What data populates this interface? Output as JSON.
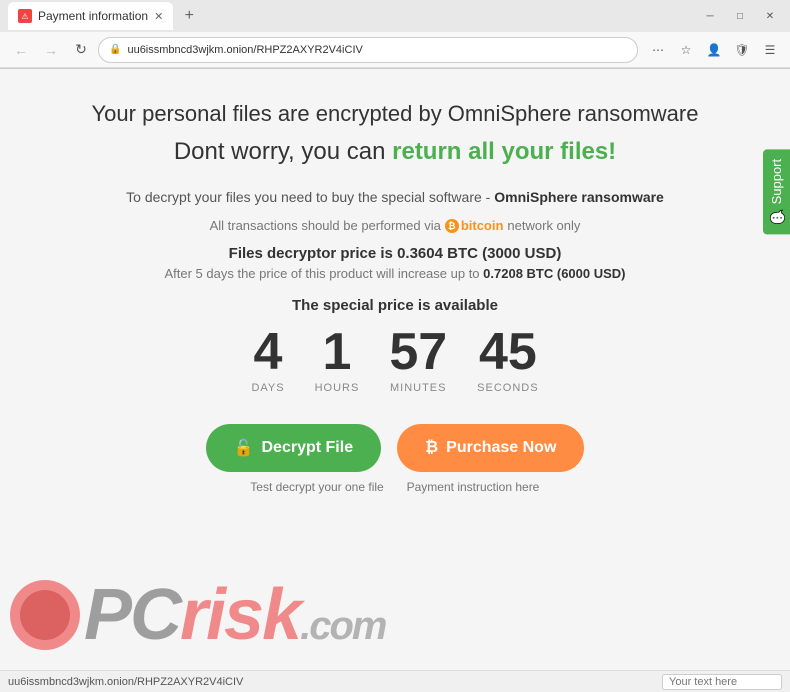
{
  "browser": {
    "tab_title": "Payment information",
    "url": "uu6issmbncd3wjkm.onion/RHPZ2AXYR2V4iCIV",
    "url_display": "uu6issmbncd3wjkm.onion/RHPZ2AXYR2V4iCIV"
  },
  "page": {
    "main_heading": "Your personal files are encrypted by OmniSphere ransomware",
    "sub_heading_prefix": "Dont worry, you can ",
    "sub_heading_highlight": "return all your files!",
    "description_prefix": "To decrypt your files you need to buy the special software - ",
    "description_brand": "OmniSphere ransomware",
    "bitcoin_text": "All transactions should be performed via",
    "bitcoin_name": "bitcoin",
    "bitcoin_suffix": "network only",
    "price_label": "Files decryptor price is ",
    "price_value": "0.3604 BTC (3000 USD)",
    "increase_prefix": "After 5 days the price of this product will increase up to ",
    "increase_price": "0.7208 BTC (6000 USD)",
    "special_label": "The special price is available",
    "countdown": {
      "days_value": "4",
      "days_label": "DAYS",
      "hours_value": "1",
      "hours_label": "HOURS",
      "minutes_value": "57",
      "minutes_label": "MINUTES",
      "seconds_value": "45",
      "seconds_label": "SECONDS"
    },
    "decrypt_button": "Decrypt File",
    "decrypt_caption": "Test decrypt your one file",
    "purchase_button": "Purchase Now",
    "purchase_caption": "Payment instruction here",
    "support_label": "Support"
  },
  "status_bar": {
    "url": "uu6issmbncd3wjkm.onion/RHPZ2AXYR2V4iCIV",
    "input_placeholder": "Your text here"
  }
}
